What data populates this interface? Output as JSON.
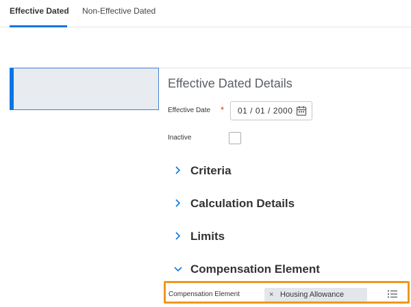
{
  "tabs": [
    {
      "label": "Effective Dated",
      "active": true
    },
    {
      "label": "Non-Effective Dated",
      "active": false
    }
  ],
  "details": {
    "title": "Effective Dated Details",
    "effective_date_label": "Effective Date",
    "required_marker": "*",
    "effective_date_value": "01 / 01 / 2000",
    "inactive_label": "Inactive",
    "inactive_checked": false
  },
  "sections": [
    {
      "label": "Criteria",
      "expanded": false
    },
    {
      "label": "Calculation Details",
      "expanded": false
    },
    {
      "label": "Limits",
      "expanded": false
    },
    {
      "label": "Compensation Element",
      "expanded": true
    }
  ],
  "compensation_element": {
    "label": "Compensation Element",
    "remove_glyph": "×",
    "selected_value": "Housing Allowance"
  },
  "icons": {
    "calendar": "calendar-icon",
    "collapsed": "chevron-right-icon",
    "expanded": "chevron-down-icon",
    "prompt": "list-icon"
  },
  "colors": {
    "accent": "#0875e1",
    "required": "#de2e21",
    "highlight": "#f0961b"
  }
}
